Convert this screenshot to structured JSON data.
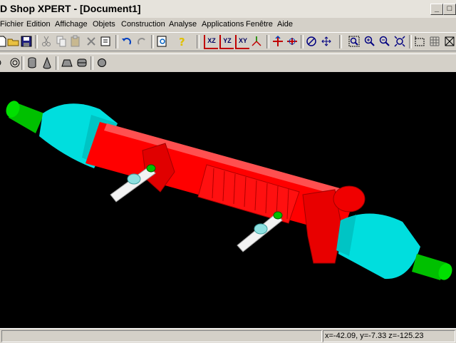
{
  "window": {
    "title": "D Shop XPERT - [Document1]",
    "min_glyph": "_",
    "max_glyph": "□"
  },
  "menu": [
    "Fichier",
    "Edition",
    "Affichage",
    "Objets",
    "Construction",
    "Analyse",
    "Applications",
    "Fenêtre",
    "Aide"
  ],
  "toolbar": {
    "view_xz": "XZ",
    "view_yz": "YZ",
    "view_xy": "XY"
  },
  "status": {
    "coordinates": "x=-42.09, y=-7.33 z=-125.23"
  },
  "colors": {
    "body": "#ff0000",
    "boots": "#00e0e0",
    "ends": "#00cc00",
    "shafts": "#f2f2f2",
    "background": "#000000"
  }
}
